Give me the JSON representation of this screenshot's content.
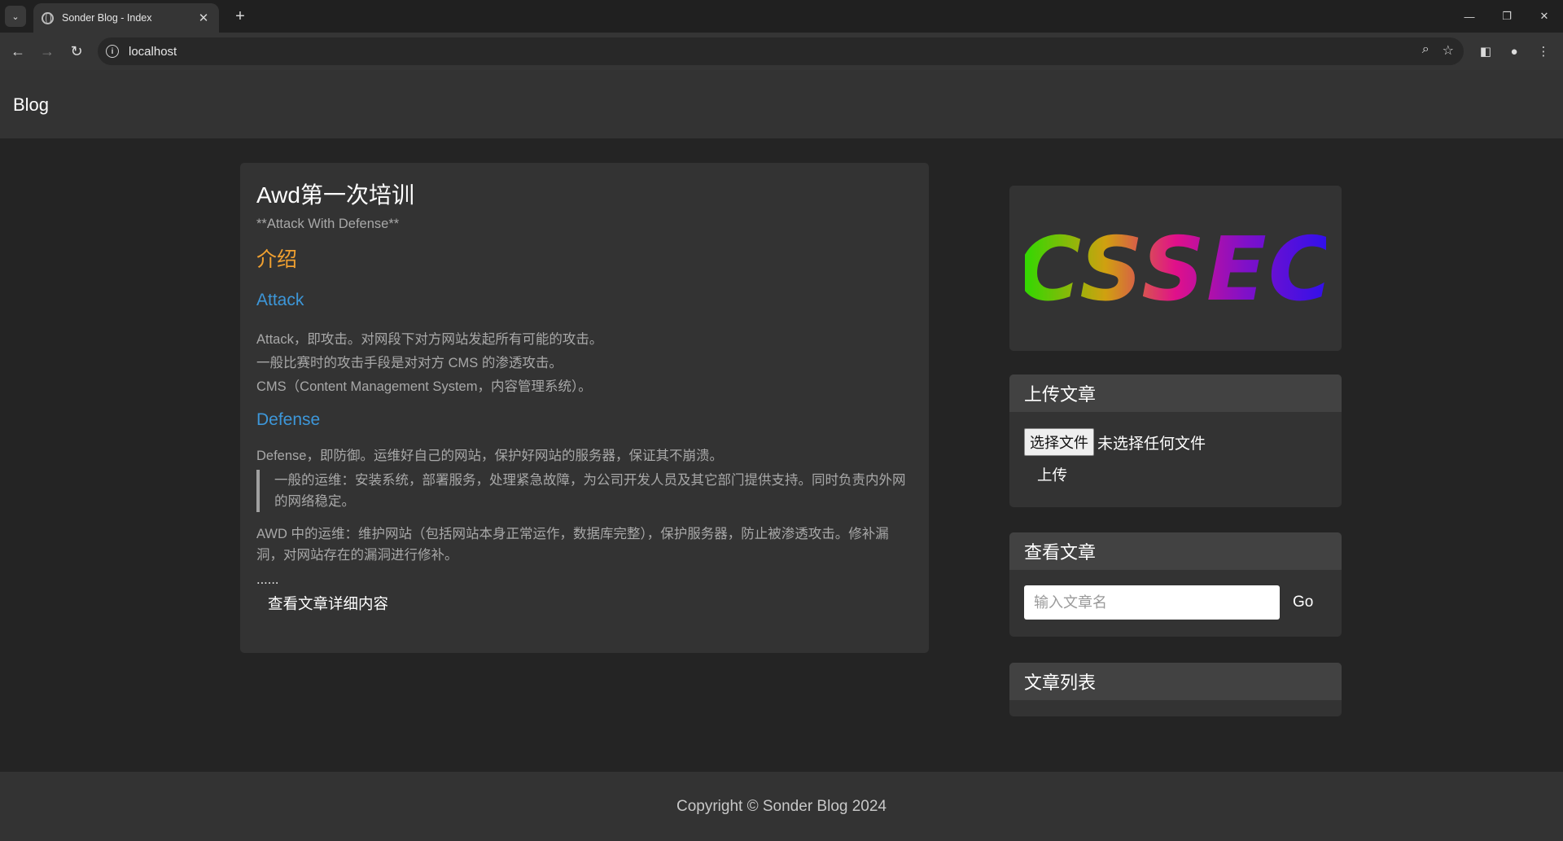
{
  "browser": {
    "tab_title": "Sonder Blog - Index",
    "new_tab": "+",
    "url": "localhost"
  },
  "header": {
    "brand": "Blog"
  },
  "post": {
    "title": "Awd第一次培训",
    "subtitle": "**Attack With Defense**",
    "intro_heading": "介绍",
    "attack_heading": "Attack",
    "attack_lines": [
      "Attack，即攻击。对网段下对方网站发起所有可能的攻击。",
      "一般比赛时的攻击手段是对对方 CMS 的渗透攻击。",
      "CMS（Content Management System，内容管理系统）。"
    ],
    "defense_heading": "Defense",
    "defense_line": "Defense，即防御。运维好自己的网站，保护好网站的服务器，保证其不崩溃。",
    "quote": "一般的运维：安装系统，部署服务，处理紧急故障，为公司开发人员及其它部门提供支持。同时负责内外网的网络稳定。",
    "awd_line": "AWD 中的运维：维护网站（包括网站本身正常运作，数据库完整），保护服务器，防止被渗透攻击。修补漏洞，对网站存在的漏洞进行修补。",
    "ellipsis": "......",
    "detail_link": "查看文章详细内容"
  },
  "sidebar": {
    "logo_text": "CSSEC",
    "upload": {
      "title": "上传文章",
      "choose_file": "选择文件",
      "no_file": "未选择任何文件",
      "submit": "上传"
    },
    "view": {
      "title": "查看文章",
      "placeholder": "输入文章名",
      "go": "Go"
    },
    "list": {
      "title": "文章列表"
    }
  },
  "footer": {
    "copyright": "Copyright © Sonder Blog 2024"
  },
  "colors": {
    "accent_heading": "#f0a030",
    "link_blue": "#3d97d9",
    "logo_gradient": [
      "#22dd00",
      "#d0a010",
      "#e0108a",
      "#8010c8",
      "#2a10ee"
    ]
  }
}
